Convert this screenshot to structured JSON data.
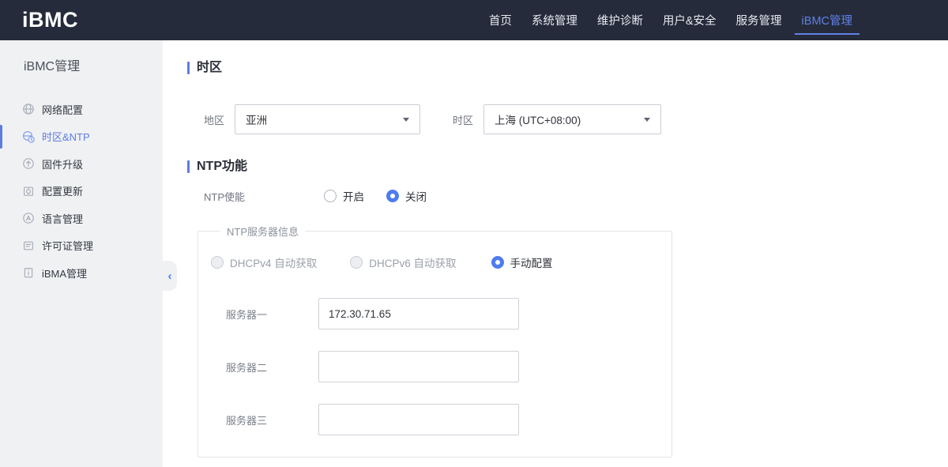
{
  "header": {
    "logo": "iBMC",
    "nav": [
      {
        "label": "首页"
      },
      {
        "label": "系统管理"
      },
      {
        "label": "维护诊断"
      },
      {
        "label": "用户&安全"
      },
      {
        "label": "服务管理"
      },
      {
        "label": "iBMC管理",
        "active": true
      }
    ]
  },
  "sidebar": {
    "title": "iBMC管理",
    "items": [
      {
        "label": "网络配置",
        "icon": "globe-icon"
      },
      {
        "label": "时区&NTP",
        "icon": "timezone-clock-icon",
        "active": true
      },
      {
        "label": "固件升级",
        "icon": "upgrade-arrow-icon"
      },
      {
        "label": "配置更新",
        "icon": "config-update-icon"
      },
      {
        "label": "语言管理",
        "icon": "language-icon"
      },
      {
        "label": "许可证管理",
        "icon": "license-icon"
      },
      {
        "label": "iBMA管理",
        "icon": "ibma-clipboard-icon"
      }
    ],
    "collapse_icon": "‹"
  },
  "main": {
    "timezone_section": {
      "title": "时区",
      "region_label": "地区",
      "region_value": "亚洲",
      "tz_label": "时区",
      "tz_value": "上海 (UTC+08:00)"
    },
    "ntp_section": {
      "title": "NTP功能",
      "enable_label": "NTP使能",
      "enable_on": "开启",
      "enable_off": "关闭",
      "server_group": {
        "legend": "NTP服务器信息",
        "mode_dhcpv4": "DHCPv4 自动获取",
        "mode_dhcpv6": "DHCPv6 自动获取",
        "mode_manual": "手动配置",
        "servers": [
          {
            "label": "服务器一",
            "value": "172.30.71.65"
          },
          {
            "label": "服务器二",
            "value": ""
          },
          {
            "label": "服务器三",
            "value": ""
          }
        ]
      }
    }
  },
  "colors": {
    "accent_blue": "#5e7ce0",
    "radio_blue": "#4e7cf0",
    "header_bg": "#252b3a",
    "sidebar_bg": "#f0f1f3"
  }
}
